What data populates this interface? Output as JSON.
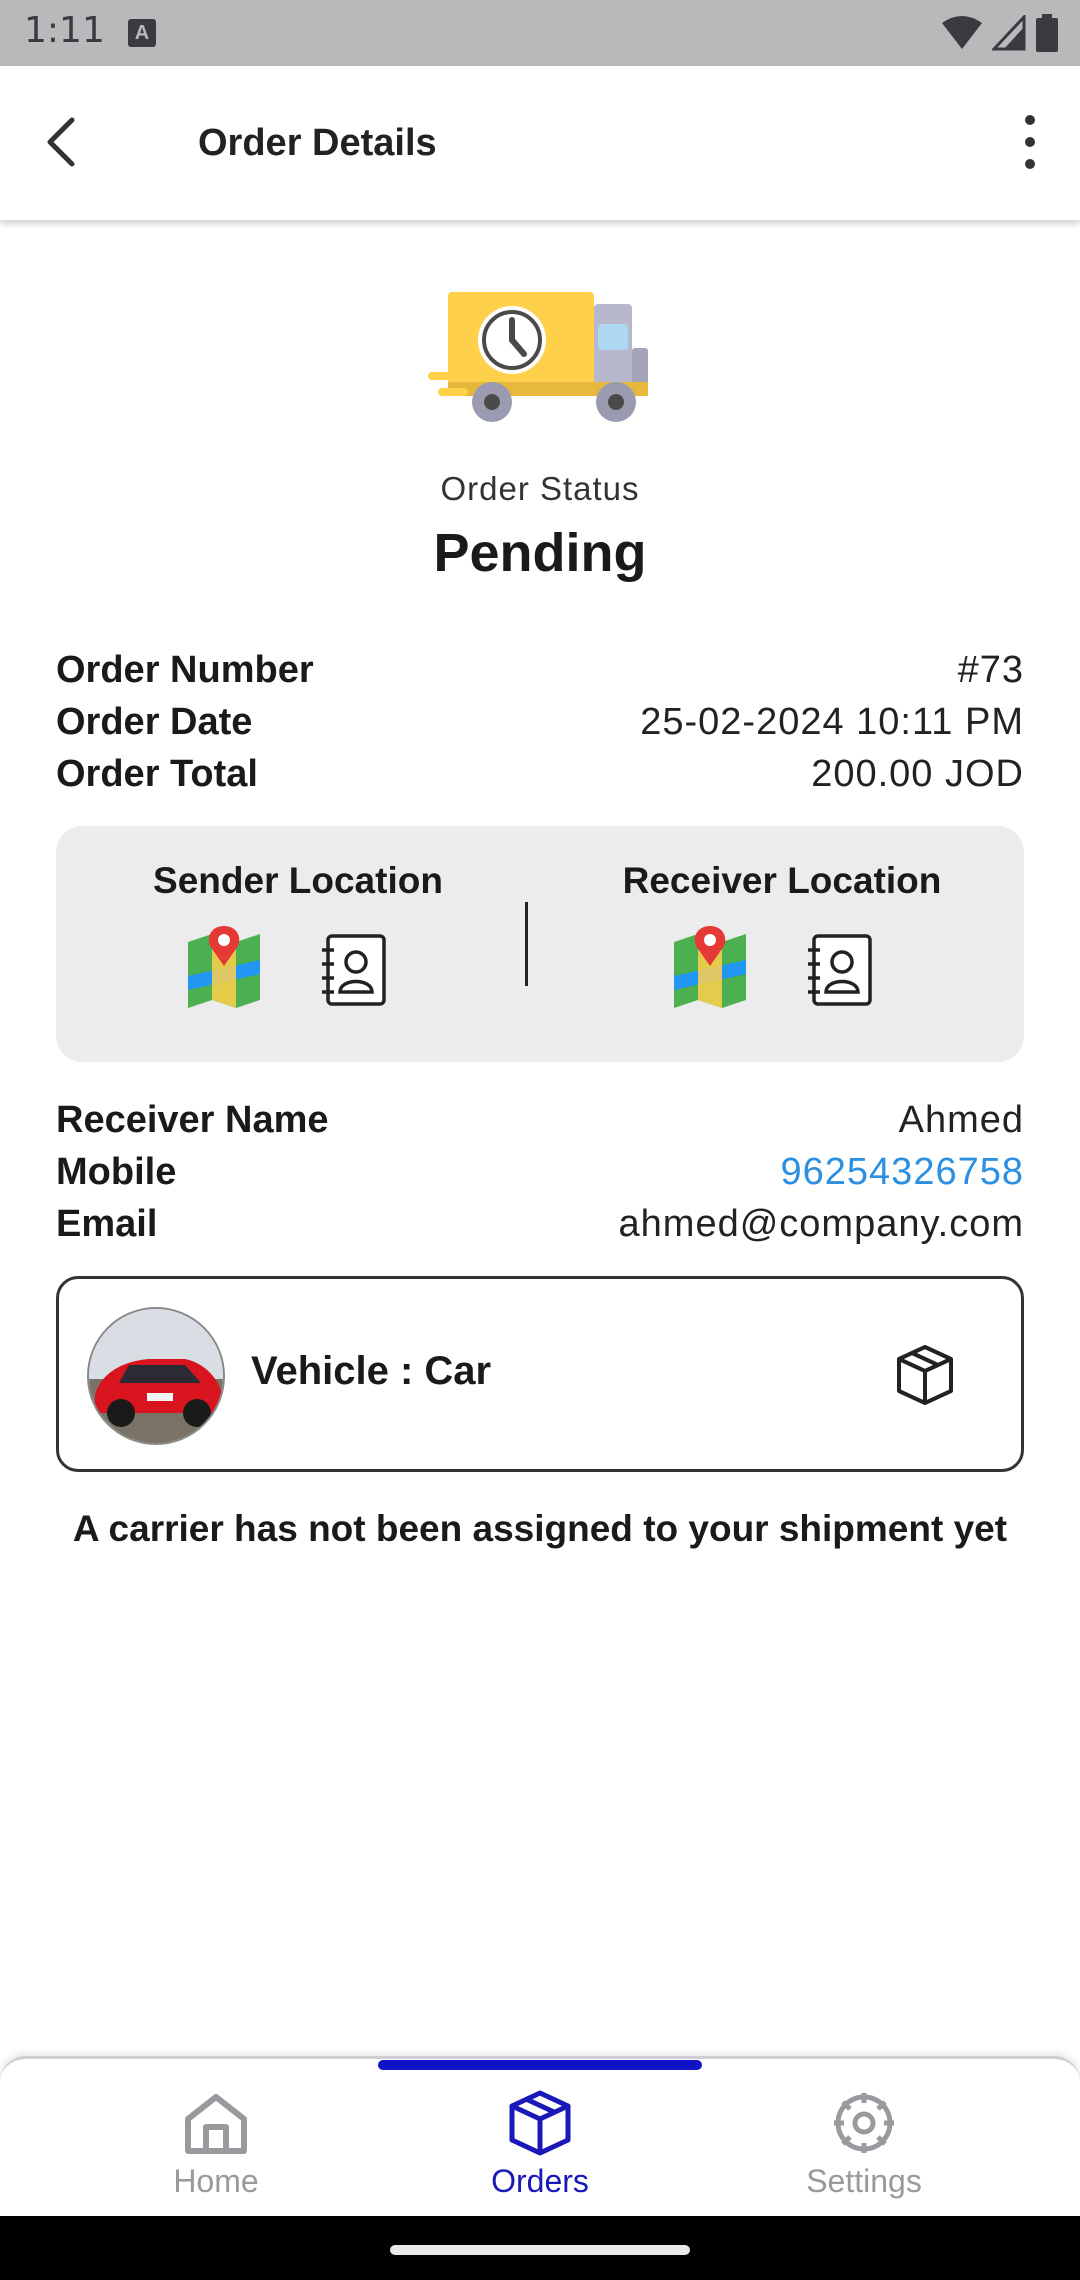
{
  "status_bar": {
    "time": "1:11",
    "notif_letter": "A"
  },
  "app_bar": {
    "title": "Order Details"
  },
  "order_status": {
    "label": "Order Status",
    "value": "Pending"
  },
  "order_info": {
    "number_label": "Order Number",
    "number_value": "#73",
    "date_label": "Order Date",
    "date_value": "25-02-2024 10:11 PM",
    "total_label": "Order Total",
    "total_value": "200.00 JOD"
  },
  "locations": {
    "sender_title": "Sender Location",
    "receiver_title": "Receiver Location"
  },
  "receiver": {
    "name_label": "Receiver Name",
    "name_value": "Ahmed",
    "mobile_label": "Mobile",
    "mobile_value": "96254326758",
    "email_label": "Email",
    "email_value": "ahmed@company.com"
  },
  "vehicle": {
    "label": "Vehicle : Car"
  },
  "carrier_message": "A carrier has not been assigned to your shipment yet",
  "bottom_nav": {
    "items": [
      {
        "label": "Home",
        "icon": "home-icon",
        "active": false
      },
      {
        "label": "Orders",
        "icon": "box-icon",
        "active": true
      },
      {
        "label": "Settings",
        "icon": "gear-icon",
        "active": false
      }
    ]
  },
  "colors": {
    "accent": "#1a18b8",
    "link": "#2d8fe0",
    "card_bg": "#ececee",
    "truck_body": "#ffd04a"
  }
}
